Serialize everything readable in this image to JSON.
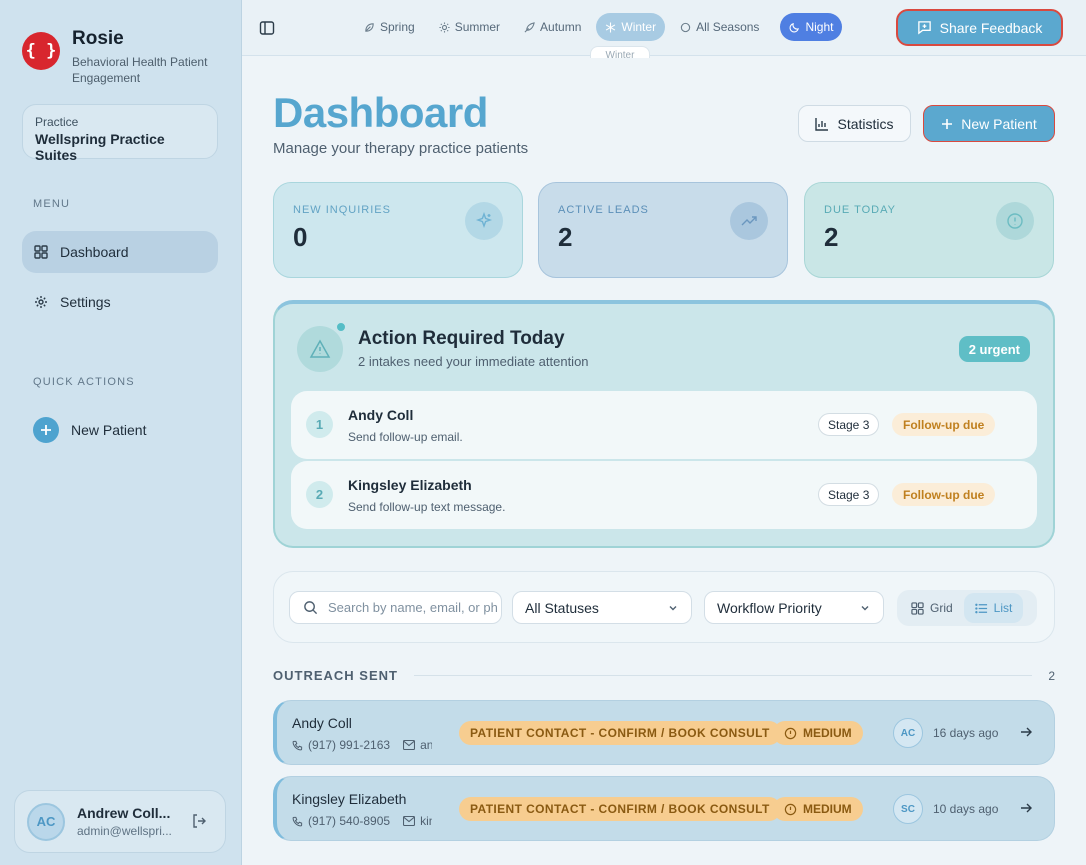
{
  "app": {
    "name": "Rosie",
    "tagline": "Behavioral Health Patient Engagement",
    "logo_glyph": "{ }",
    "accent": "#5ba8cf",
    "brand_red": "#d8262e"
  },
  "sidebar": {
    "practice_label": "Practice",
    "practice_name": "Wellspring Practice Suites",
    "menu_label": "MENU",
    "menu": [
      {
        "label": "Dashboard",
        "icon": "grid-icon",
        "active": true
      },
      {
        "label": "Settings",
        "icon": "gear-icon",
        "active": false
      }
    ],
    "quick_actions_label": "QUICK ACTIONS",
    "quick_actions": [
      {
        "label": "New Patient",
        "icon": "plus-icon"
      }
    ],
    "user": {
      "initials": "AC",
      "name": "Andrew Coll...",
      "email": "admin@wellspri..."
    }
  },
  "topbar": {
    "seasons": [
      {
        "label": "Spring",
        "icon": "leaf-icon",
        "active": false
      },
      {
        "label": "Summer",
        "icon": "sun-icon",
        "active": false
      },
      {
        "label": "Autumn",
        "icon": "leaf-icon",
        "active": false
      },
      {
        "label": "Winter",
        "icon": "snowflake-icon",
        "active": true
      },
      {
        "label": "All Seasons",
        "icon": "circle-icon",
        "active": false
      }
    ],
    "night_label": "Night",
    "season_tooltip": "Winter",
    "share_feedback": "Share Feedback"
  },
  "header": {
    "title": "Dashboard",
    "subtitle": "Manage your therapy practice patients",
    "statistics_button": "Statistics",
    "new_patient_button": "New Patient"
  },
  "stats": [
    {
      "label": "NEW INQUIRIES",
      "value": "0",
      "icon": "sparkle-icon"
    },
    {
      "label": "ACTIVE LEADS",
      "value": "2",
      "icon": "trending-up-icon"
    },
    {
      "label": "DUE TODAY",
      "value": "2",
      "icon": "alert-circle-icon"
    }
  ],
  "action_required": {
    "title": "Action Required Today",
    "subtitle": "2 intakes need your immediate attention",
    "badge": "2 urgent",
    "items": [
      {
        "num": "1",
        "name": "Andy Coll",
        "desc": "Send follow-up email.",
        "stage": "Stage 3",
        "status": "Follow-up due"
      },
      {
        "num": "2",
        "name": "Kingsley Elizabeth",
        "desc": "Send follow-up text message.",
        "stage": "Stage 3",
        "status": "Follow-up due"
      }
    ]
  },
  "filters": {
    "search_placeholder": "Search by name, email, or phone...",
    "status_select": "All Statuses",
    "sort_select": "Workflow Priority",
    "view_grid": "Grid",
    "view_list": "List",
    "active_view": "List"
  },
  "group": {
    "title": "OUTREACH SENT",
    "count": "2",
    "rows": [
      {
        "name": "Andy Coll",
        "phone": "(917) 991-2163",
        "email": "andy",
        "status": "PATIENT CONTACT - CONFIRM / BOOK CONSULT",
        "priority": "MEDIUM",
        "initials": "AC",
        "time": "16 days ago"
      },
      {
        "name": "Kingsley Elizabeth",
        "phone": "(917) 540-8905",
        "email": "kingsley",
        "status": "PATIENT CONTACT - CONFIRM / BOOK CONSULT",
        "priority": "MEDIUM",
        "initials": "SC",
        "time": "10 days ago"
      }
    ]
  }
}
